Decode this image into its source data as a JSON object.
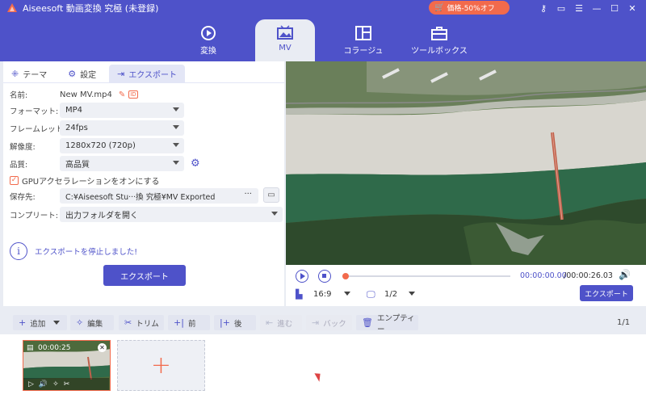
{
  "app": {
    "title": "Aiseesoft 動画変換 究極 (未登録)",
    "promo": "価格-50%オフ",
    "colors": {
      "primary": "#4e52c9",
      "accent": "#f26a4c"
    }
  },
  "nav": {
    "tabs": [
      {
        "label": "変換",
        "icon": "convert-icon"
      },
      {
        "label": "MV",
        "icon": "mv-icon",
        "active": true
      },
      {
        "label": "コラージュ",
        "icon": "collage-icon"
      },
      {
        "label": "ツールボックス",
        "icon": "toolbox-icon"
      }
    ]
  },
  "panel": {
    "tabs": [
      "テーマ",
      "設定",
      "エクスポート"
    ],
    "active_tab": "エクスポート",
    "name_label": "名前:",
    "name_value": "New MV.mp4",
    "format_label": "フォーマット:",
    "format_value": "MP4",
    "framerate_label": "フレームレット:",
    "framerate_value": "24fps",
    "resolution_label": "解像度:",
    "resolution_value": "1280x720 (720p)",
    "quality_label": "品質:",
    "quality_value": "高品質",
    "gpu_label": "GPUアクセラレーションをオンにする",
    "gpu_checked": true,
    "save_label": "保存先:",
    "save_value": "C:¥Aiseesoft Stu···換 究極¥MV Exported",
    "save_more": "···",
    "complete_label": "コンプリート:",
    "complete_value": "出力フォルダを開く",
    "info_text": "エクスポートを停止しました!",
    "export_button": "エクスポート"
  },
  "player": {
    "current_time": "00:00:00.00",
    "total_time": "/00:00:26.03",
    "progress": 0.0,
    "ratio": "16:9",
    "pages": "1/2",
    "export_button": "エクスポート"
  },
  "toolbar": {
    "buttons": [
      {
        "label": "追加",
        "icon": "plus-icon",
        "enabled": true
      },
      {
        "label": "編集",
        "icon": "magic-wand-icon",
        "enabled": true
      },
      {
        "label": "トリム",
        "icon": "scissors-icon",
        "enabled": true
      },
      {
        "label": "前",
        "icon": "insert-before-icon",
        "enabled": true
      },
      {
        "label": "後",
        "icon": "insert-after-icon",
        "enabled": true
      },
      {
        "label": "進む",
        "icon": "forward-icon",
        "enabled": false
      },
      {
        "label": "バック",
        "icon": "back-icon",
        "enabled": false
      },
      {
        "label": "エンプティー",
        "icon": "trash-icon",
        "enabled": true
      }
    ],
    "page_count": "1/1"
  },
  "timeline": {
    "clip_duration": "00:00:25"
  }
}
